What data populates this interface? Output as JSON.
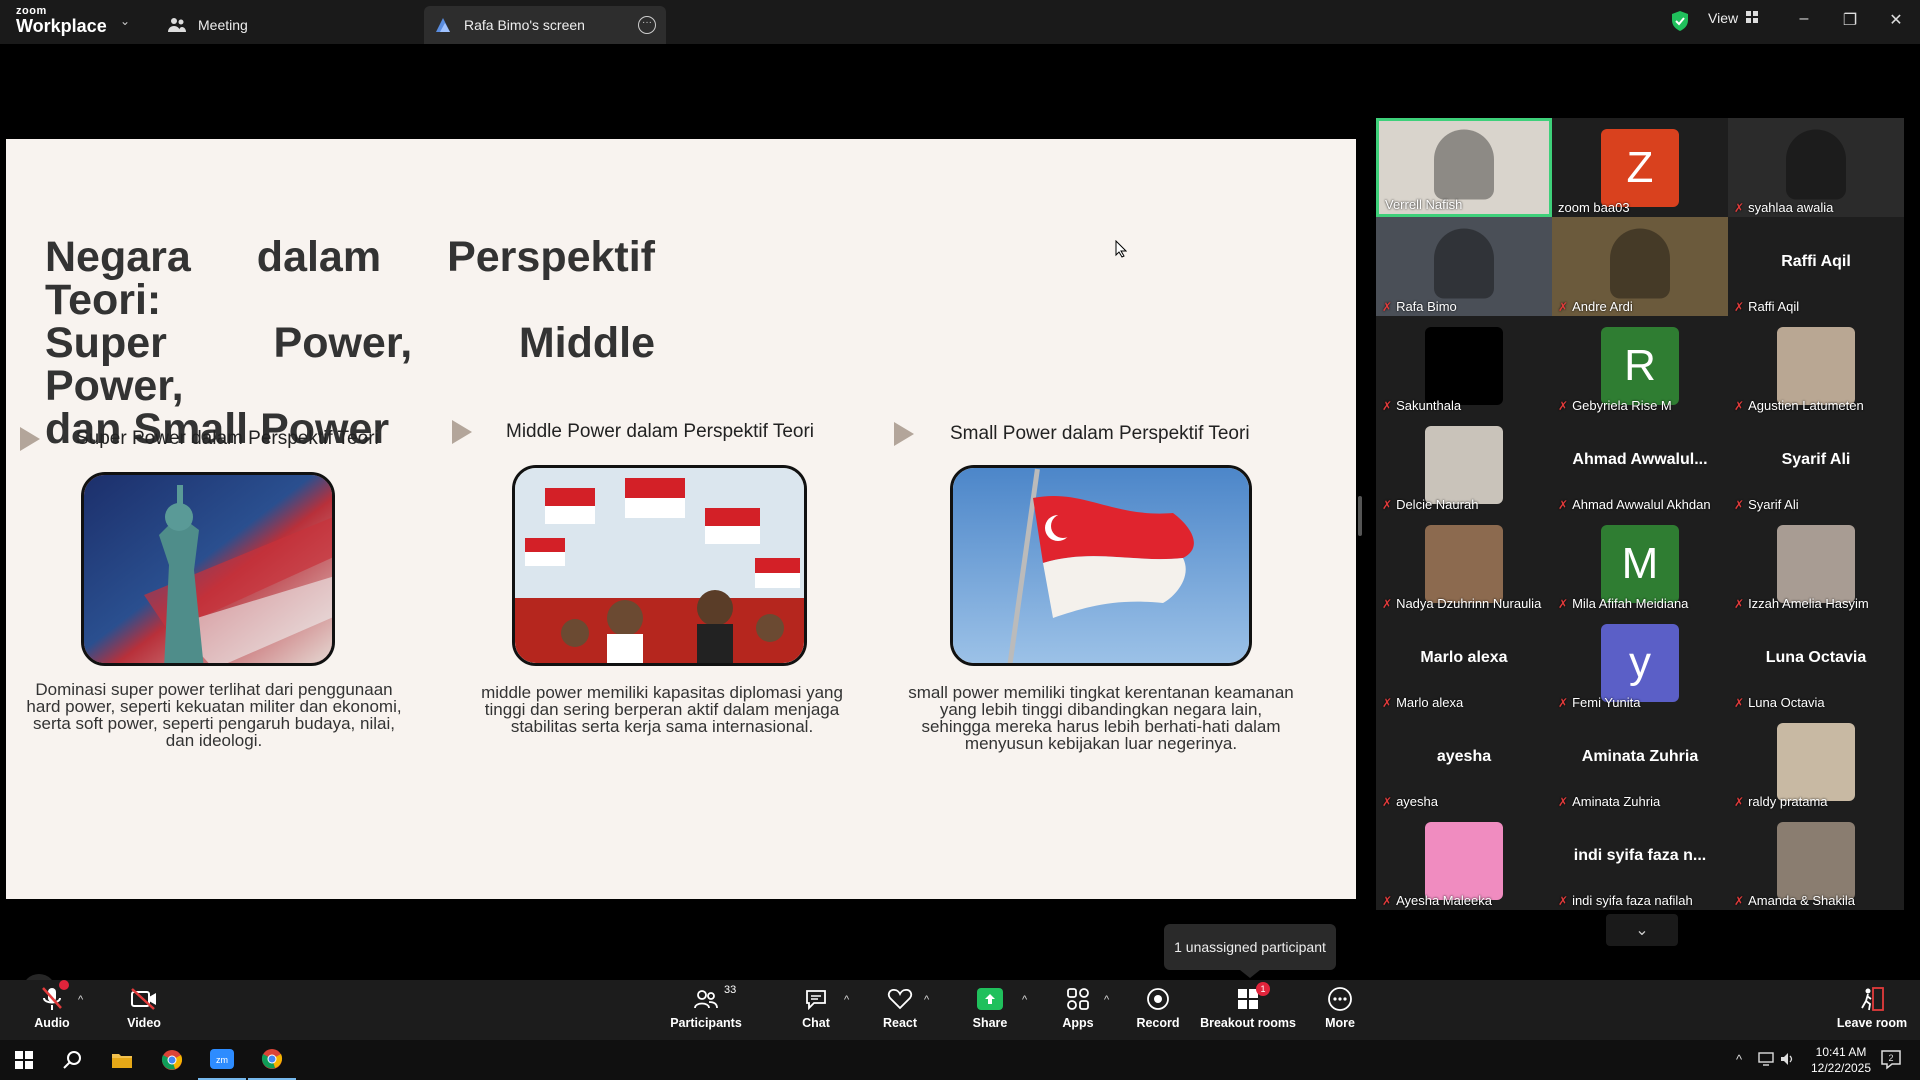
{
  "app": {
    "logo_top": "zoom",
    "logo_bottom": "Workplace"
  },
  "tabs": {
    "meeting": "Meeting",
    "screen": "Rafa Bimo's screen"
  },
  "header": {
    "view_label": "View"
  },
  "slide": {
    "title_line1": "Negara dalam Perspektif Teori:",
    "title_line2": "Super Power, Middle Power,",
    "title_line3": "dan Small Power",
    "columns": [
      {
        "heading": "Super Power dalam Perspektif Teori",
        "image": "usa-flag-statue-of-liberty",
        "text": "Dominasi super power terlihat dari penggunaan hard power, seperti kekuatan militer dan ekonomi, serta soft power, seperti pengaruh budaya, nilai, dan ideologi."
      },
      {
        "heading": "Middle Power dalam Perspektif Teori",
        "image": "indonesia-flags-crowd",
        "text": "middle power memiliki kapasitas diplomasi yang tinggi dan sering berperan aktif dalam menjaga stabilitas serta kerja sama internasional."
      },
      {
        "heading": "Small Power dalam Perspektif Teori",
        "image": "singapore-flag",
        "text": "small power memiliki tingkat kerentanan keamanan yang lebih tinggi dibandingkan negara lain, sehingga mereka harus lebih berhati-hati dalam menyusun kebijakan luar negerinya."
      }
    ]
  },
  "gallery": {
    "participants": [
      {
        "name": "Verrell Nafish",
        "type": "video",
        "muted": false,
        "active": true,
        "color": "#d9d4cc"
      },
      {
        "name": "zoom baa03",
        "type": "letter",
        "letter": "Z",
        "muted": false,
        "color": "#d9411e"
      },
      {
        "name": "syahlaa awalia",
        "type": "video",
        "muted": true,
        "color": "#2b2b2b"
      },
      {
        "name": "Rafa Bimo",
        "type": "video",
        "muted": true,
        "color": "#4a4f57"
      },
      {
        "name": "Andre Ardi",
        "type": "video",
        "muted": true,
        "color": "#6b5a3c"
      },
      {
        "name": "Raffi Aqil",
        "type": "nameonly",
        "big": "Raffi Aqil",
        "muted": true
      },
      {
        "name": "Sakunthala",
        "type": "black",
        "muted": true,
        "color": "#000000"
      },
      {
        "name": "Gebyriela Rise M",
        "type": "letter",
        "letter": "R",
        "muted": true,
        "color": "#2f7d32"
      },
      {
        "name": "Agustien Latumeten",
        "type": "photo",
        "muted": true,
        "color": "#b9a793"
      },
      {
        "name": "Delcie Naurah",
        "type": "photo",
        "muted": true,
        "color": "#c9c3ba"
      },
      {
        "name": "Ahmad Awwalul Akhdan",
        "type": "nameonly",
        "big": "Ahmad  Awwalul...",
        "muted": true
      },
      {
        "name": "Syarif Ali",
        "type": "nameonly",
        "big": "Syarif Ali",
        "muted": true
      },
      {
        "name": "Nadya Dzuhrinn Nuraulia",
        "type": "photo",
        "muted": true,
        "color": "#8c6a4f"
      },
      {
        "name": "Mila Afifah Meidiana",
        "type": "letter",
        "letter": "M",
        "muted": true,
        "color": "#2f7d32"
      },
      {
        "name": "Izzah Amelia Hasyim",
        "type": "photo",
        "muted": true,
        "color": "#a89c93"
      },
      {
        "name": "Marlo alexa",
        "type": "nameonly",
        "big": "Marlo alexa",
        "muted": true
      },
      {
        "name": "Femi Yunita",
        "type": "letter",
        "letter": "y",
        "muted": true,
        "color": "#5b5fc7"
      },
      {
        "name": "Luna Octavia",
        "type": "nameonly",
        "big": "Luna Octavia",
        "muted": true
      },
      {
        "name": "ayesha",
        "type": "nameonly",
        "big": "ayesha",
        "muted": true
      },
      {
        "name": "Aminata Zuhria",
        "type": "nameonly",
        "big": "Aminata Zuhria",
        "muted": true
      },
      {
        "name": "raldy pratama",
        "type": "photo",
        "muted": true,
        "color": "#c8b9a3"
      },
      {
        "name": "Ayesha Maleeka",
        "type": "photo",
        "muted": true,
        "color": "#f08cc0"
      },
      {
        "name": "indi syifa faza nafilah",
        "type": "nameonly",
        "big": "indi syifa faza n...",
        "muted": true
      },
      {
        "name": "Amanda & Shakila",
        "type": "photo",
        "muted": true,
        "color": "#8a7d70"
      }
    ]
  },
  "tooltip": "1 unassigned participant",
  "toolbar": {
    "audio": "Audio",
    "video": "Video",
    "participants": "Participants",
    "participants_count": "33",
    "chat": "Chat",
    "react": "React",
    "share": "Share",
    "apps": "Apps",
    "record": "Record",
    "breakout": "Breakout rooms",
    "breakout_badge": "1",
    "more": "More",
    "leave": "Leave room"
  },
  "taskbar": {
    "time": "10:41 AM",
    "date": "12/22/2025",
    "notif_count": "2"
  },
  "colors": {
    "accent_green": "#20c05c",
    "active_border": "#3ed07a",
    "muted_red": "#e23b3b",
    "slide_bg": "#f8f3ef"
  }
}
